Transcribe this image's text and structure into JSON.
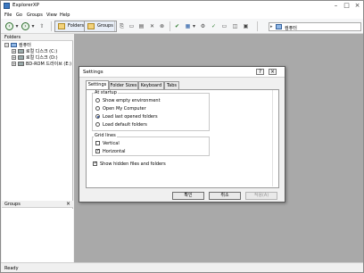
{
  "window": {
    "title": "ExplorerXP",
    "minimize": "–",
    "maximize": "□",
    "close": "×"
  },
  "menu": [
    "File",
    "Go",
    "Groups",
    "View",
    "Help"
  ],
  "toolbar": {
    "folders_label": "Folders",
    "groups_label": "Groups",
    "address_value": "컴퓨터"
  },
  "folders_panel": {
    "header": "Folders",
    "tree": [
      {
        "label": "컴퓨터",
        "toggle": "−"
      },
      {
        "label": "로컬 디스크 (C:)",
        "toggle": "+"
      },
      {
        "label": "로컬 디스크 (D:)",
        "toggle": "+"
      },
      {
        "label": "BD-ROM 드라이브 (E:)",
        "toggle": "+"
      }
    ]
  },
  "groups_panel": {
    "header": "Groups",
    "close": "×"
  },
  "status": {
    "text": "Ready"
  },
  "dialog": {
    "title": "Settings",
    "help": "?",
    "close": "×",
    "tabs": [
      "Settings",
      "Folder Sizes",
      "Keyboard",
      "Tabs"
    ],
    "active_tab": "Settings",
    "startup": {
      "label": "At startup",
      "options": [
        {
          "label": "Show empty environment",
          "selected": false
        },
        {
          "label": "Open My Computer",
          "selected": false
        },
        {
          "label": "Load last opened folders",
          "selected": true
        },
        {
          "label": "Load default folders",
          "selected": false
        }
      ]
    },
    "gridlines": {
      "label": "Grid lines",
      "options": [
        {
          "label": "Vertical",
          "checked": false
        },
        {
          "label": "Horizontal",
          "checked": true
        }
      ]
    },
    "hidden_files": {
      "label": "Show hidden files and folders",
      "checked": true
    },
    "buttons": {
      "ok": "확인",
      "cancel": "취소",
      "apply": "적용(A)"
    }
  }
}
